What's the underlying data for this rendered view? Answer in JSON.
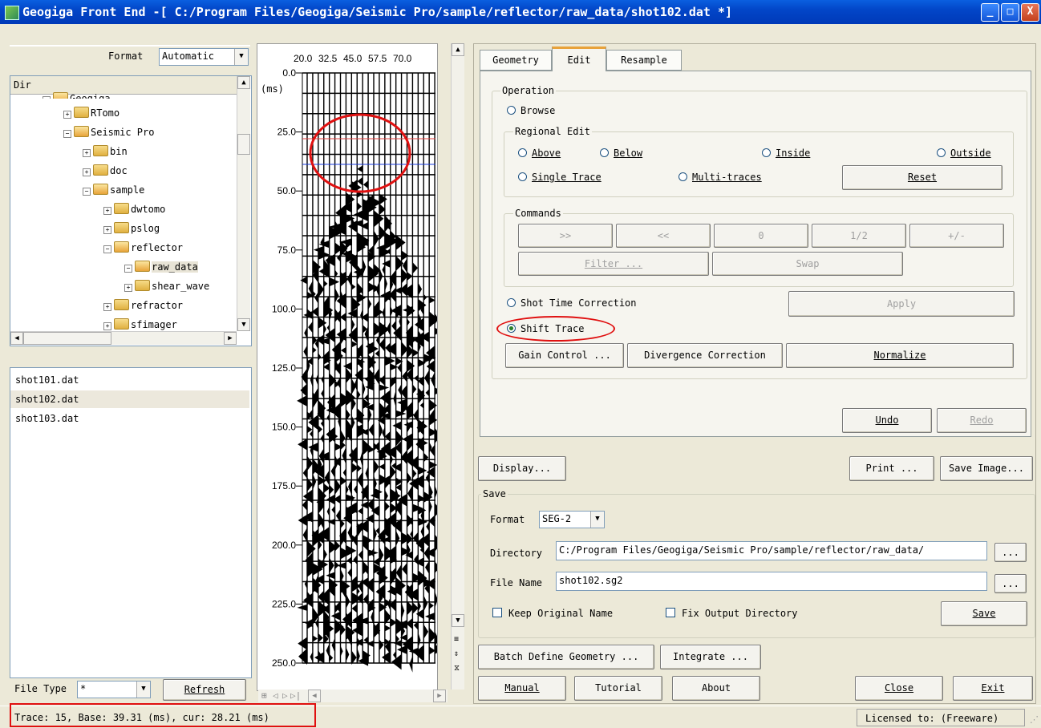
{
  "window": {
    "title": "Geogiga Front End -[ C:/Program Files/Geogiga/Seismic Pro/sample/reflector/raw_data/shot102.dat *]",
    "minimize": "_",
    "maximize": "□",
    "close": "X"
  },
  "left": {
    "format_label": "Format",
    "format_value": "Automatic",
    "dir_header": "Dir",
    "tree": [
      {
        "label": "Geogiga",
        "open": true
      },
      {
        "label": "RTomo",
        "open": false
      },
      {
        "label": "Seismic Pro",
        "open": true
      },
      {
        "label": "bin",
        "open": false
      },
      {
        "label": "doc",
        "open": false
      },
      {
        "label": "sample",
        "open": true
      },
      {
        "label": "dwtomo",
        "open": false
      },
      {
        "label": "pslog",
        "open": false
      },
      {
        "label": "reflector",
        "open": true
      },
      {
        "label": "raw_data",
        "open": true
      },
      {
        "label": "shear_wave",
        "open": false
      },
      {
        "label": "refractor",
        "open": false
      },
      {
        "label": "sfimager",
        "open": false
      }
    ],
    "files": [
      "shot101.dat",
      "shot102.dat",
      "shot103.dat"
    ],
    "selected_file": "shot102.dat",
    "file_type_label": "File Type",
    "file_type_value": "*",
    "refresh_button": "Refresh"
  },
  "plot": {
    "x_ticks": [
      "20.0",
      "32.5",
      "45.0",
      "57.5",
      "70.0"
    ],
    "y_ticks": [
      "0.0",
      "25.0",
      "50.0",
      "75.0",
      "100.0",
      "125.0",
      "150.0",
      "175.0",
      "200.0",
      "225.0",
      "250.0"
    ],
    "y_unit": "(ms)",
    "nav_buttons": [
      "⊞",
      "◁",
      "▷",
      "▷|"
    ]
  },
  "tabs": [
    "Geometry",
    "Edit",
    "Resample"
  ],
  "active_tab": "Edit",
  "operation": {
    "group": "Operation",
    "browse": "Browse",
    "regional_group": "Regional Edit",
    "above": "Above",
    "below": "Below",
    "inside": "Inside",
    "outside": "Outside",
    "single_trace": "Single Trace",
    "multi_traces": "Multi-traces",
    "reset": "Reset",
    "commands_group": "Commands",
    "cmd_buttons": [
      ">>",
      "<<",
      "0",
      "1/2",
      "+/-"
    ],
    "filter": "Filter ...",
    "swap": "Swap",
    "shot_time_correction": "Shot Time Correction",
    "apply": "Apply",
    "shift_trace": "Shift Trace",
    "gain_control": "Gain Control ...",
    "divergence_correction": "Divergence Correction",
    "normalize": "Normalize",
    "undo": "Undo",
    "redo": "Redo"
  },
  "actions": {
    "display": "Display...",
    "print": "Print ...",
    "save_image": "Save Image..."
  },
  "save": {
    "group": "Save",
    "format_label": "Format",
    "format_value": "SEG-2",
    "directory_label": "Directory",
    "directory_value": "C:/Program Files/Geogiga/Seismic Pro/sample/reflector/raw_data/",
    "filename_label": "File Name",
    "filename_value": "shot102.sg2",
    "browse": "...",
    "keep_name": "Keep Original Name",
    "fix_dir": "Fix Output Directory",
    "save_button": "Save"
  },
  "bottom": {
    "batch": "Batch Define Geometry ...",
    "integrate": "Integrate ...",
    "manual": "Manual",
    "tutorial": "Tutorial",
    "about": "About",
    "close": "Close",
    "exit": "Exit"
  },
  "status": {
    "left": "Trace: 15, Base: 39.31 (ms), cur: 28.21 (ms)",
    "right": "Licensed to: (Freeware)"
  },
  "colors": {
    "title_blue": "#0246c8",
    "annotation_red": "#e01010",
    "base_line": "#1a3bd8",
    "cur_line": "#e04040"
  }
}
